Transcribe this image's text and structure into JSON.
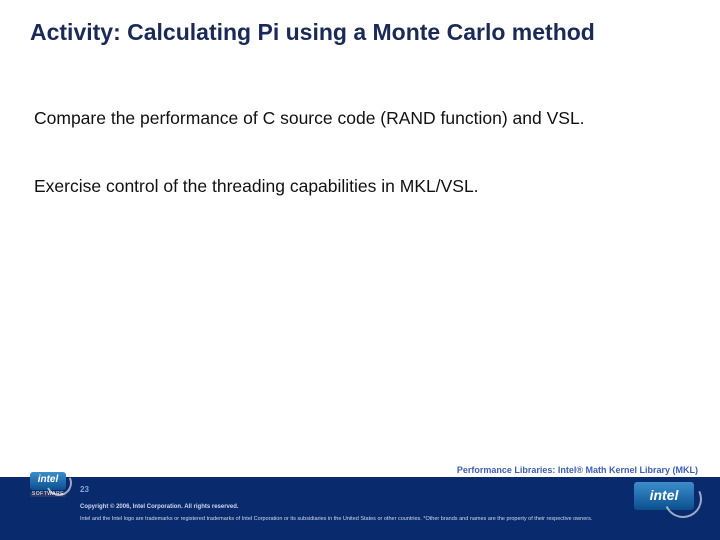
{
  "title": "Activity: Calculating Pi using a Monte Carlo method",
  "body1": "Compare the performance of C source code (RAND function) and VSL.",
  "body2": "Exercise control of the threading capabilities in MKL/VSL.",
  "footer_title": "Performance Libraries: Intel® Math Kernel Library (MKL)",
  "slide_number": "23",
  "copyright": "Copyright © 2006, Intel Corporation. All rights reserved.",
  "trademark": "Intel and the Intel logo are trademarks or registered trademarks of Intel Corporation or its subsidiaries in the United States or other countries. *Other brands and names are the property of their respective owners.",
  "logo_text": "intel",
  "software_label": "SOFTWARE"
}
